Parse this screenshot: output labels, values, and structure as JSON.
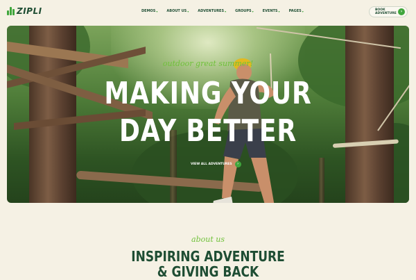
{
  "brand": {
    "name": "ZIPLI",
    "accent": "#3fa63c",
    "dark": "#1e4d33"
  },
  "nav": {
    "items": [
      {
        "label": "DEMOS"
      },
      {
        "label": "ABOUT US"
      },
      {
        "label": "ADVENTURES"
      },
      {
        "label": "GROUPS"
      },
      {
        "label": "EVENTS"
      },
      {
        "label": "PAGES"
      }
    ],
    "caret_icon": "chevron-down-icon"
  },
  "header": {
    "book_label": "BOOK ADVENTURE",
    "book_icon": "arrow-right-icon"
  },
  "hero": {
    "tagline": "outdoor great summer!",
    "title_line1": "MAKING YOUR",
    "title_line2": "DAY BETTER",
    "link_label": "VIEW ALL ADVENTURES",
    "link_icon": "arrow-right-icon"
  },
  "about": {
    "eyebrow": "about us",
    "title_line1": "INSPIRING ADVENTURE",
    "title_line2": "& GIVING BACK"
  }
}
